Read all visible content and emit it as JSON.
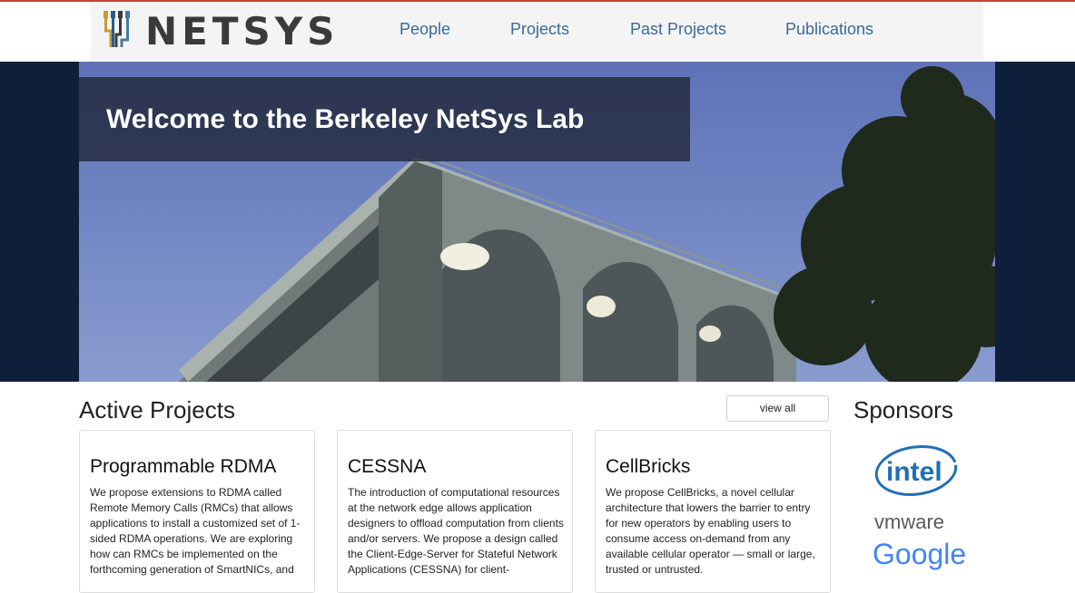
{
  "nav": {
    "logo_text": "NETSYS",
    "items": [
      {
        "label": "People"
      },
      {
        "label": "Projects"
      },
      {
        "label": "Past Projects"
      },
      {
        "label": "Publications"
      }
    ]
  },
  "hero": {
    "welcome": "Welcome to the Berkeley NetSys Lab"
  },
  "active_projects": {
    "title": "Active Projects",
    "view_all": "view all",
    "cards": [
      {
        "title": "Programmable RDMA",
        "body": "We propose extensions to RDMA called Remote Memory Calls (RMCs) that allows applications to install a customized set of 1-sided RDMA operations. We are exploring how can RMCs be implemented on the forthcoming generation of SmartNICs, and"
      },
      {
        "title": "CESSNA",
        "body": "The introduction of computational resources at the network edge allows application designers to offload computation from clients and/or servers. We propose a design called the Client-Edge-Server for Stateful Network Applications (CESSNA) for client-"
      },
      {
        "title": "CellBricks",
        "body": "We propose CellBricks, a novel cellular architecture that lowers the barrier to entry for new operators by enabling users to consume access on-demand from any available cellular operator — small or large, trusted or untrusted."
      }
    ]
  },
  "sponsors": {
    "title": "Sponsors",
    "logos": [
      {
        "name": "intel",
        "text": "intel"
      },
      {
        "name": "vmware",
        "text": "vmware"
      },
      {
        "name": "google",
        "text": "Google"
      }
    ]
  },
  "colors": {
    "accent_line": "#c9423b",
    "nav_link": "#3b6a95",
    "hero_band": "#0e1f3c"
  }
}
